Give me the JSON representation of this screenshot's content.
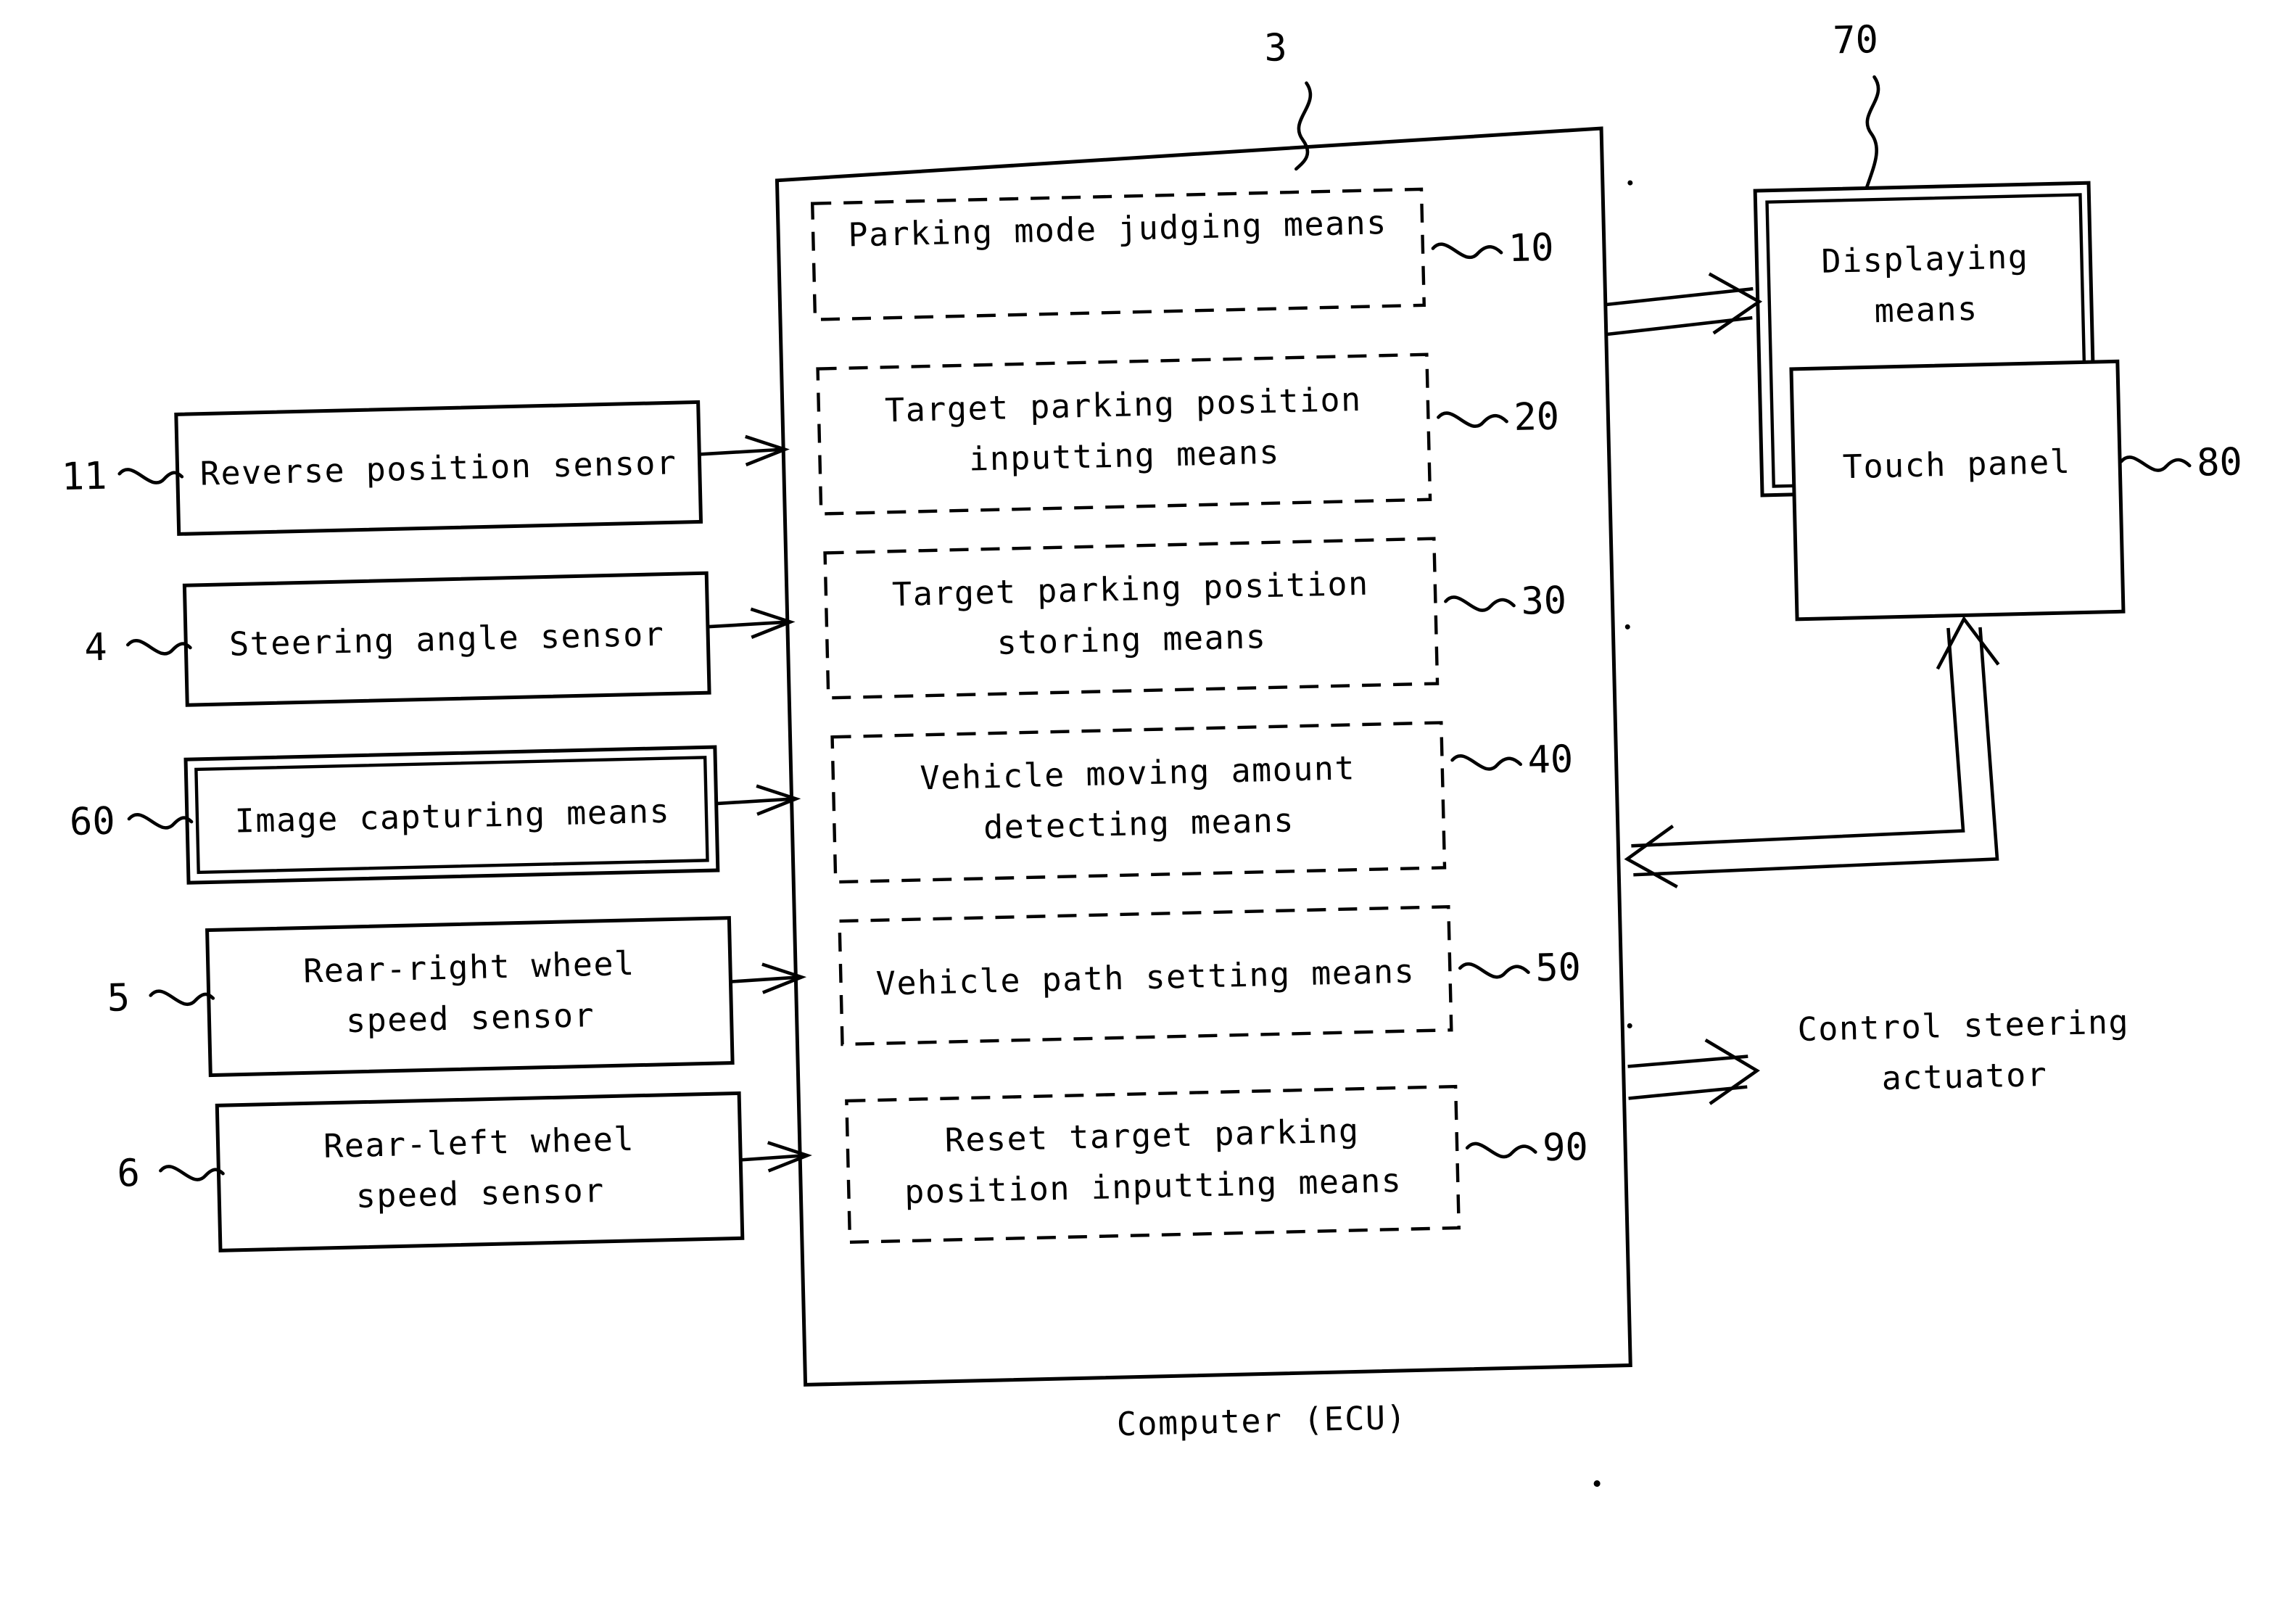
{
  "figure": {
    "caption": "Computer (ECU)",
    "external_output_label_line1": "Control steering",
    "external_output_label_line2": "actuator"
  },
  "reference_numerals": {
    "ecu": "3",
    "display_unit": "70",
    "touch_panel": "80",
    "reverse_position_sensor": "11",
    "steering_angle_sensor": "4",
    "image_capturing_means": "60",
    "rear_right_wheel_speed_sensor": "5",
    "rear_left_wheel_speed_sensor": "6",
    "parking_mode_judging_means": "10",
    "target_parking_position_inputting_means": "20",
    "target_parking_position_storing_means": "30",
    "vehicle_moving_amount_detecting_means": "40",
    "vehicle_path_setting_means": "50",
    "reset_target_parking_position_inputting_means": "90"
  },
  "inputs": [
    {
      "id": "reverse-position-sensor",
      "label_line1": "Reverse position sensor",
      "label_line2": "",
      "ref": "11",
      "double_border": false
    },
    {
      "id": "steering-angle-sensor",
      "label_line1": "Steering angle sensor",
      "label_line2": "",
      "ref": "4",
      "double_border": false
    },
    {
      "id": "image-capturing-means",
      "label_line1": "Image capturing means",
      "label_line2": "",
      "ref": "60",
      "double_border": true
    },
    {
      "id": "rear-right-wheel-speed-sensor",
      "label_line1": "Rear-right wheel",
      "label_line2": "speed sensor",
      "ref": "5",
      "double_border": false
    },
    {
      "id": "rear-left-wheel-speed-sensor",
      "label_line1": "Rear-left wheel",
      "label_line2": "speed sensor",
      "ref": "6",
      "double_border": false
    }
  ],
  "ecu_modules": [
    {
      "id": "parking-mode-judging-means",
      "label_line1": "Parking mode judging means",
      "label_line2": "",
      "ref": "10"
    },
    {
      "id": "target-parking-position-inputting-means",
      "label_line1": "Target parking position",
      "label_line2": "inputting means",
      "ref": "20"
    },
    {
      "id": "target-parking-position-storing-means",
      "label_line1": "Target parking position",
      "label_line2": "storing means",
      "ref": "30"
    },
    {
      "id": "vehicle-moving-amount-detecting-means",
      "label_line1": "Vehicle moving amount",
      "label_line2": "detecting means",
      "ref": "40"
    },
    {
      "id": "vehicle-path-setting-means",
      "label_line1": "Vehicle path setting means",
      "label_line2": "",
      "ref": "50"
    },
    {
      "id": "reset-target-parking-position-inputting-means",
      "label_line1": "Reset target parking",
      "label_line2": "position inputting means",
      "ref": "90"
    }
  ],
  "outputs": [
    {
      "id": "displaying-means",
      "label_line1": "Displaying",
      "label_line2": "means",
      "ref": "70",
      "double_border": true
    },
    {
      "id": "touch-panel",
      "label_line1": "Touch panel",
      "label_line2": "",
      "ref": "80",
      "double_border": false
    }
  ],
  "colors": {
    "ink": "#000000",
    "paper": "#ffffff"
  }
}
